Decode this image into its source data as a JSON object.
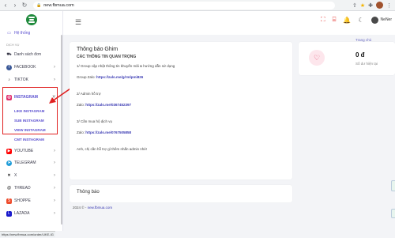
{
  "browser": {
    "url": "new.fbmua.com",
    "status_url": "https://new.fbmua.com/order/LIKE-IG"
  },
  "sidebar": {
    "top_item": "Hệ thống",
    "section_label": "DỊCH VỤ",
    "items": [
      {
        "label": "Danh sách đơn",
        "icon": "cart-icon"
      },
      {
        "label": "FACEBOOK",
        "icon": "facebook-icon"
      },
      {
        "label": "TIKTOK",
        "icon": "tiktok-icon"
      },
      {
        "label": "INSTAGRAM",
        "icon": "instagram-icon"
      },
      {
        "label": "YOUTUBE",
        "icon": "youtube-icon"
      },
      {
        "label": "TELEGRAM",
        "icon": "telegram-icon"
      },
      {
        "label": "X",
        "icon": "x-icon"
      },
      {
        "label": "THREAD",
        "icon": "thread-icon"
      },
      {
        "label": "SHOPPE",
        "icon": "shopee-icon"
      },
      {
        "label": "LAZADA",
        "icon": "lazada-icon"
      }
    ],
    "instagram_sub": [
      "LIKE INSTAGRAM",
      "SUB INSTAGRAM",
      "VIEW INSTAGRAM",
      "CMT INSTAGRAM"
    ]
  },
  "header": {
    "username": "NeNer",
    "breadcrumb": "Trang chủ"
  },
  "pinned": {
    "title": "Thông báo Ghim",
    "subtitle": "CÁC THÔNG TIN QUAN TRỌNG",
    "line1": "1/ Group cập nhật thông tin khuyến mãi & hướng dẫn sử dụng",
    "line2_label": "Group Zalo: ",
    "line2_link": "https://zalo.me/g/rmlpmi826",
    "line3": "2/ Admin hỗ trợ",
    "line4_label": "Zalo: ",
    "line4_link": "https://zalo.me/0367452397",
    "line5": "3/ Cần mua hộ dịch vụ",
    "line6_label": "Zalo: ",
    "line6_link": "https://zalo.me/0767505858",
    "line7": "Anh, chị cần hỗ trợ gì thêm nhắn admin nhé!"
  },
  "notice": {
    "title": "Thông báo"
  },
  "balance": {
    "value": "0 đ",
    "label": "Số dư hiện tại"
  },
  "footer": {
    "year": "2024 © - ",
    "link": "new.fbmua.com"
  },
  "colors": {
    "accent": "#5a4fcf",
    "highlight": "#e02020",
    "brand": "#1f8a3c"
  }
}
